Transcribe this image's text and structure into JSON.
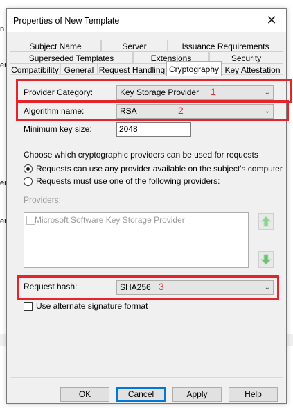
{
  "background": {
    "fragments": [
      "n",
      "er",
      "er",
      "er"
    ]
  },
  "dialog": {
    "title": "Properties of New Template",
    "close_glyph": "✕"
  },
  "tabs": {
    "row1": [
      "Subject Name",
      "Server",
      "Issuance Requirements"
    ],
    "row2": [
      "Superseded Templates",
      "Extensions",
      "Security"
    ],
    "row3": [
      "Compatibility",
      "General",
      "Request Handling",
      "Cryptography",
      "Key Attestation"
    ],
    "active": "Cryptography"
  },
  "crypto": {
    "provider_category_label": "Provider Category:",
    "provider_category_value": "Key Storage Provider",
    "algorithm_label": "Algorithm name:",
    "algorithm_value": "RSA",
    "min_key_label": "Minimum key size:",
    "min_key_value": "2048",
    "choose_text": "Choose which cryptographic providers can be used for requests",
    "radio_any": "Requests can use any provider available on the subject's computer",
    "radio_specific": "Requests must use one of the following providers:",
    "providers_label": "Providers:",
    "provider_item": "Microsoft Software Key Storage Provider",
    "request_hash_label": "Request hash:",
    "request_hash_value": "SHA256",
    "alternate_sig_label": "Use alternate signature format"
  },
  "annotations": {
    "labels": [
      "1",
      "2",
      "3"
    ],
    "color": "#e3242b"
  },
  "buttons": {
    "ok": "OK",
    "cancel": "Cancel",
    "apply": "Apply",
    "help": "Help"
  },
  "colors": {
    "accent": "#0078d7",
    "up_arrow": "#7fc97f",
    "down_arrow": "#6cc070"
  }
}
